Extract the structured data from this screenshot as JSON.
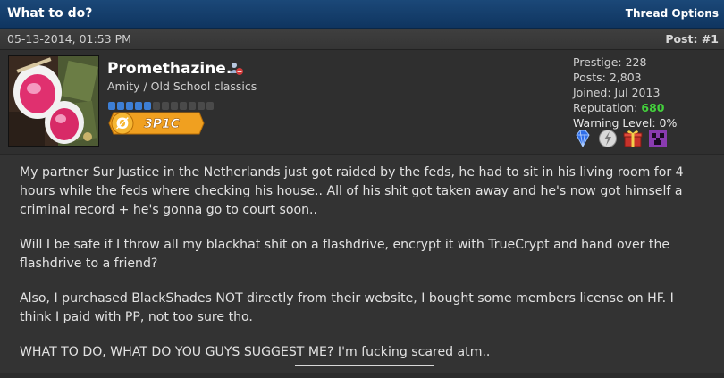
{
  "thread": {
    "title": "What to do?",
    "options_label": "Thread Options"
  },
  "post": {
    "date": "05-13-2014, 01:53 PM",
    "number": "Post: #1"
  },
  "user": {
    "name": "Promethazine.",
    "title": "Amity / Old School classics",
    "rank_dots_filled": 5,
    "rank_dots_total": 12,
    "badge_text": "3P1C",
    "badge_symbol": "Ø"
  },
  "stats": {
    "prestige": "Prestige: 228",
    "posts": "Posts: 2,803",
    "joined": "Joined: Jul 2013",
    "reputation_label": "Reputation:",
    "reputation_value": "680",
    "warning": "Warning Level: 0%"
  },
  "awards": [
    "diamond-award-icon",
    "lightning-award-icon",
    "gift-award-icon",
    "creeper-award-icon"
  ],
  "message": {
    "p1": "My partner Sur Justice in the Netherlands just got raided by the feds, he had to sit in his living room for 4 hours while the feds where checking his house.. All of his shit got taken away and he's now got himself a criminal record + he's gonna go to court soon..",
    "p2": "Will I be safe if I throw all my blackhat shit on a flashdrive, encrypt it with TrueCrypt and hand over the flashdrive to a friend?",
    "p3": "Also, I purchased BlackShades NOT directly from their website, I bought some members license on HF. I think I paid with PP, not too sure tho.",
    "p4": "WHAT TO DO, WHAT DO YOU GUYS SUGGEST ME? I'm fucking scared atm.."
  },
  "colors": {
    "header": "#1b4878",
    "reputation": "#43d13c",
    "rank_dot_on": "#3d7fd6",
    "rank_dot_off": "#4a4a4a",
    "badge": "#f0a020"
  }
}
